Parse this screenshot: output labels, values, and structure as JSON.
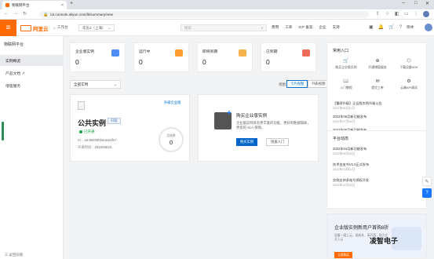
{
  "browser": {
    "tab_title": "物联网平台",
    "url": "iot.console.aliyun.com/lk/summary/new"
  },
  "header": {
    "logo": "阿里云",
    "workbench": "工作台",
    "region": "华东2（上海）",
    "search_placeholder": "搜索...",
    "nav": [
      "费用",
      "工单",
      "ICP 备案",
      "企业",
      "支持"
    ],
    "lang": "简体"
  },
  "sidebar": {
    "title": "物联网平台",
    "items": [
      {
        "label": "实例概览",
        "active": true
      },
      {
        "label": "产品文档 ↗",
        "active": false
      },
      {
        "label": "增值服务",
        "active": false
      }
    ],
    "collapse": "☰ 返回旧版"
  },
  "stats": [
    {
      "label": "企业版实例",
      "value": "0",
      "color": "#4b8df5"
    },
    {
      "label": "运行中",
      "value": "0",
      "color": "#ff9a2e"
    },
    {
      "label": "即将到期",
      "value": "0",
      "color": "#f6b24b"
    },
    {
      "label": "已到期",
      "value": "0",
      "color": "#f06a5a"
    }
  ],
  "filter": {
    "select": "全部实例",
    "view_label": "视图：",
    "views": [
      "卡片视图",
      "列表视图"
    ]
  },
  "instance": {
    "upgrade": "升级企业版",
    "title": "公共实例",
    "tag": "旧版",
    "status": "已开通",
    "id_label": "ID：",
    "id_value": "iot-06z00hh4nexi2fn7",
    "time_label": "开通时间：",
    "time_value": "2022/06/23",
    "gauge_label": "设备数",
    "gauge_value": "0"
  },
  "promo": {
    "title": "购买企业版实例",
    "desc": "企业版实例具有更丰富的功能，更好的数据隔离，更高的 SLA 保障。",
    "buy": "购买实例",
    "quick": "快速入门"
  },
  "quick_entry": {
    "title": "常用入口",
    "items": [
      {
        "label": "购买企业版实例",
        "icon": "cart-icon"
      },
      {
        "label": "开通增值服务",
        "icon": "plus-icon"
      },
      {
        "label": "下载设备SDK",
        "icon": "cube-icon"
      },
      {
        "label": "入门教程",
        "icon": "book-icon"
      },
      {
        "label": "提交工单",
        "icon": "ticket-icon"
      },
      {
        "label": "云端API调试",
        "icon": "api-icon"
      }
    ]
  },
  "news": {
    "items": [
      {
        "title": "【重磅升级】企业版实例升级公告",
        "date": "2021年06月30日"
      },
      {
        "title": "2022年06月新功能发布",
        "date": "2022年07月04日"
      },
      {
        "title": "2022年05月新功能发布",
        "date": "2022年06月01日"
      }
    ]
  },
  "trends": {
    "title": "平台动态",
    "items": [
      {
        "title": "2022年04月新功能发布",
        "date": "2022年05月05日"
      },
      {
        "title": "技术白皮书V1.0正式发布",
        "date": "2022年03月02日"
      },
      {
        "title": "实例支持多账号授权开发",
        "date": "2021年12月28日"
      }
    ]
  },
  "banner": {
    "title": "企业版实例新用户首购8折",
    "desc": "设备一键上云，低成本、高可用，助力企业上云",
    "button": "立即购买"
  },
  "watermark": "凌智电子"
}
